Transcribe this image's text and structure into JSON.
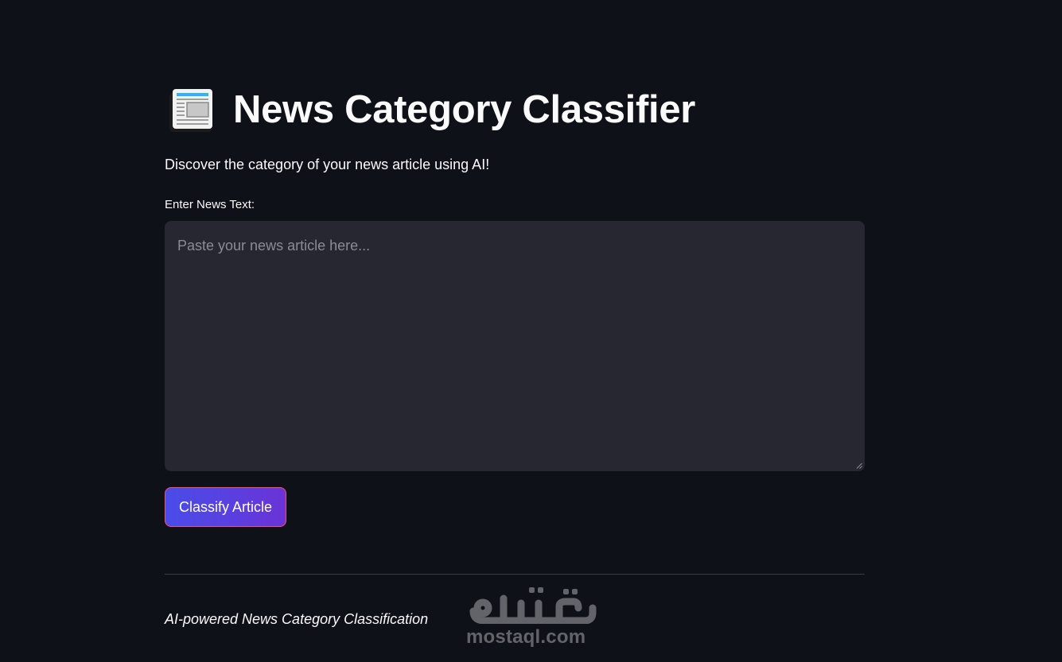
{
  "header": {
    "title": "News Category Classifier",
    "icon": "newspaper-icon"
  },
  "subtitle": "Discover the category of your news article using AI!",
  "input": {
    "label": "Enter News Text:",
    "value": "",
    "placeholder": "Paste your news article here..."
  },
  "actions": {
    "classify_label": "Classify Article"
  },
  "footer": {
    "caption": "AI-powered News Category Classification"
  },
  "watermark": {
    "logo_text": "مستقل",
    "domain": "mostaql.com"
  },
  "colors": {
    "background": "#0e1117",
    "input_background": "#262730",
    "button_gradient_start": "#4a4ce8",
    "button_gradient_end": "#6a33d6",
    "button_border": "#ff4b6e"
  }
}
